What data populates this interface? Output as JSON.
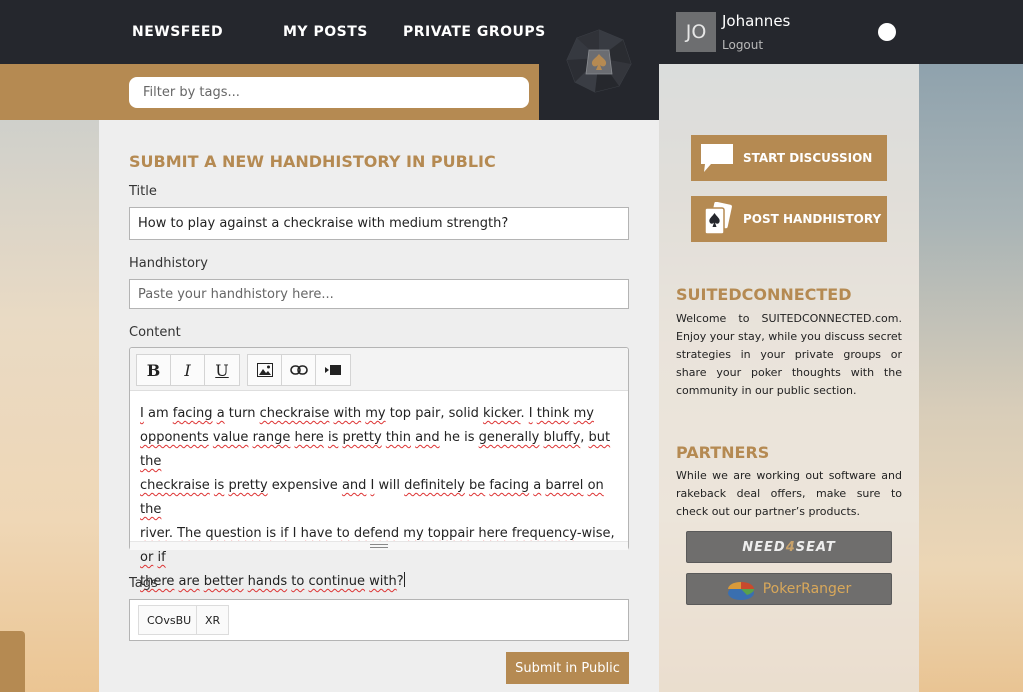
{
  "nav": {
    "items": [
      {
        "label": "NEWSFEED"
      },
      {
        "label": "MY POSTS"
      },
      {
        "label": "PRIVATE GROUPS"
      }
    ]
  },
  "filter": {
    "placeholder": "Filter by tags..."
  },
  "user": {
    "initials": "JO",
    "name": "Johannes",
    "logout_label": "Logout"
  },
  "form": {
    "heading": "SUBMIT A NEW HANDHISTORY IN PUBLIC",
    "title_label": "Title",
    "title_value": "How to play against a checkraise with medium strength?",
    "handhistory_label": "Handhistory",
    "handhistory_placeholder": "Paste your handhistory here...",
    "content_label": "Content",
    "content_lines": [
      "I am facing a turn checkraise with my top pair, solid kicker. I think my",
      "opponents value range here is pretty thin and he is generally bluffy, but the",
      "checkraise is pretty expensive and I will definitely be facing a barrel on the",
      "river. The question is if I have to defend my toppair here frequency-wise, or if",
      "there are better hands to continue with?"
    ],
    "toolbar": {
      "bold": "B",
      "italic": "I",
      "underline": "U"
    },
    "tags_label": "Tags",
    "tags": [
      "COvsBU",
      "XR"
    ],
    "submit_label": "Submit in Public"
  },
  "sidebar": {
    "start_discussion_label": "START DISCUSSION",
    "post_handhistory_label": "POST HANDHISTORY",
    "about_heading": "SUITEDCONNECTED",
    "about_text": "Welcome to SUITEDCONNECTED.com. Enjoy your stay, while you discuss secret strategies in your private groups or share your poker thoughts with the community in our public section.",
    "partners_heading": "PARTNERS",
    "partners_text": "While we are working out software and rakeback deal offers, make sure to check out our partner’s products.",
    "partners": [
      {
        "logo_text_a": "NEED",
        "logo_text_b": "4",
        "logo_text_c": "SEAT"
      },
      {
        "logo_text": "PokerRanger"
      }
    ]
  },
  "colors": {
    "accent": "#b58a52",
    "topbar": "#25272d",
    "panel": "#eeeeee"
  }
}
